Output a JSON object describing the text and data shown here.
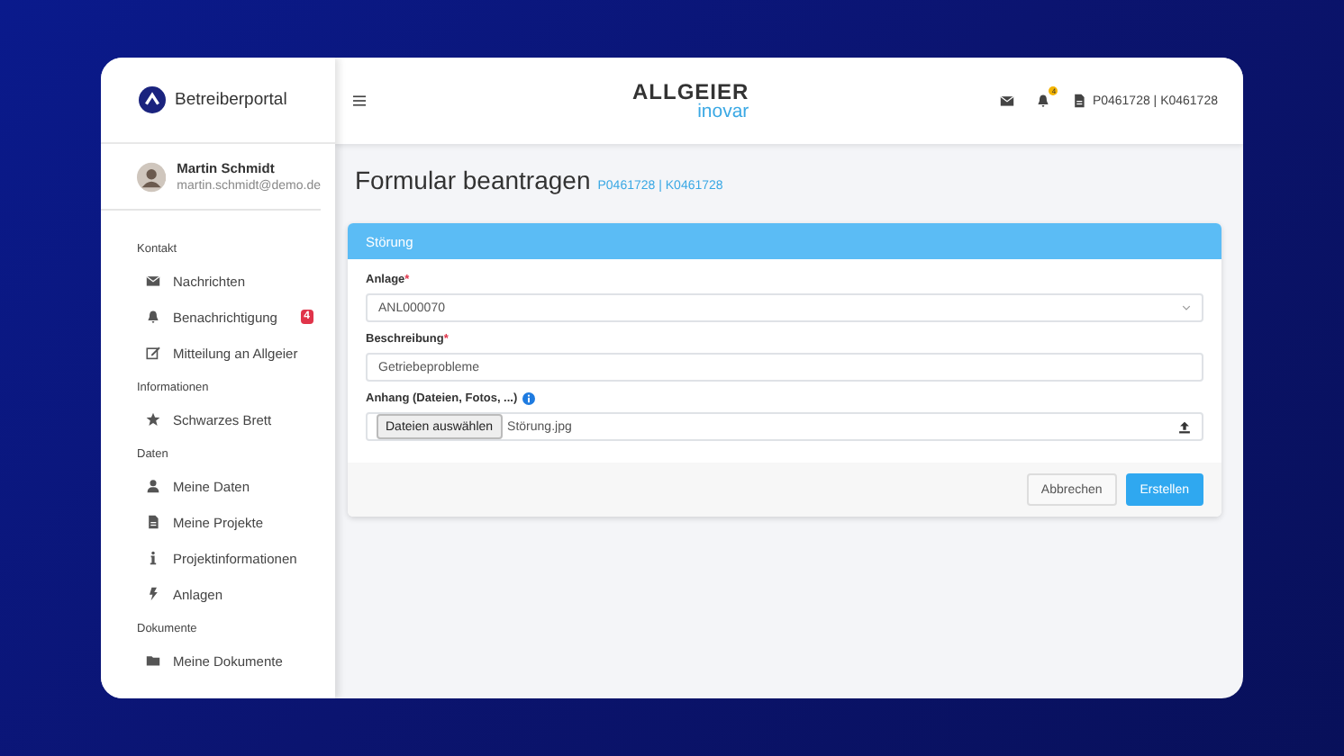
{
  "app": {
    "name": "Betreiberportal"
  },
  "user": {
    "name": "Martin Schmidt",
    "email": "martin.schmidt@demo.de"
  },
  "sidebar": {
    "sections": [
      {
        "title": "Kontakt",
        "items": [
          {
            "label": "Nachrichten",
            "kind": "envelope"
          },
          {
            "label": "Benachrichtigung",
            "kind": "bell",
            "badge": "4"
          },
          {
            "label": "Mitteilung an Allgeier",
            "kind": "edit"
          }
        ]
      },
      {
        "title": "Informationen",
        "items": [
          {
            "label": "Schwarzes Brett",
            "kind": "star"
          }
        ]
      },
      {
        "title": "Daten",
        "items": [
          {
            "label": "Meine Daten",
            "kind": "user"
          },
          {
            "label": "Meine Projekte",
            "kind": "file"
          },
          {
            "label": "Projektinformationen",
            "kind": "info"
          },
          {
            "label": "Anlagen",
            "kind": "bolt"
          }
        ]
      },
      {
        "title": "Dokumente",
        "items": [
          {
            "label": "Meine Dokumente",
            "kind": "folder"
          }
        ]
      }
    ]
  },
  "header": {
    "logo_top": "ALLGEIER",
    "logo_bottom": "inovar",
    "bell_badge": "4",
    "project": "P0461728 | K0461728"
  },
  "page": {
    "title": "Formular beantragen",
    "subtitle": "P0461728 | K0461728"
  },
  "card": {
    "title": "Störung",
    "fields": [
      {
        "kind": "select",
        "label": "Anlage",
        "required_mark": "*",
        "value": "ANL000070"
      },
      {
        "kind": "text",
        "label": "Beschreibung",
        "required_mark": "*",
        "value": "Getriebeprobleme"
      },
      {
        "kind": "file",
        "label": "Anhang (Dateien, Fotos, ...)",
        "info": true,
        "button": "Dateien auswählen",
        "value": "Störung.jpg"
      }
    ],
    "buttons": [
      {
        "label": "Abbrechen",
        "kind": "secondary"
      },
      {
        "label": "Erstellen",
        "kind": "primary"
      }
    ]
  }
}
